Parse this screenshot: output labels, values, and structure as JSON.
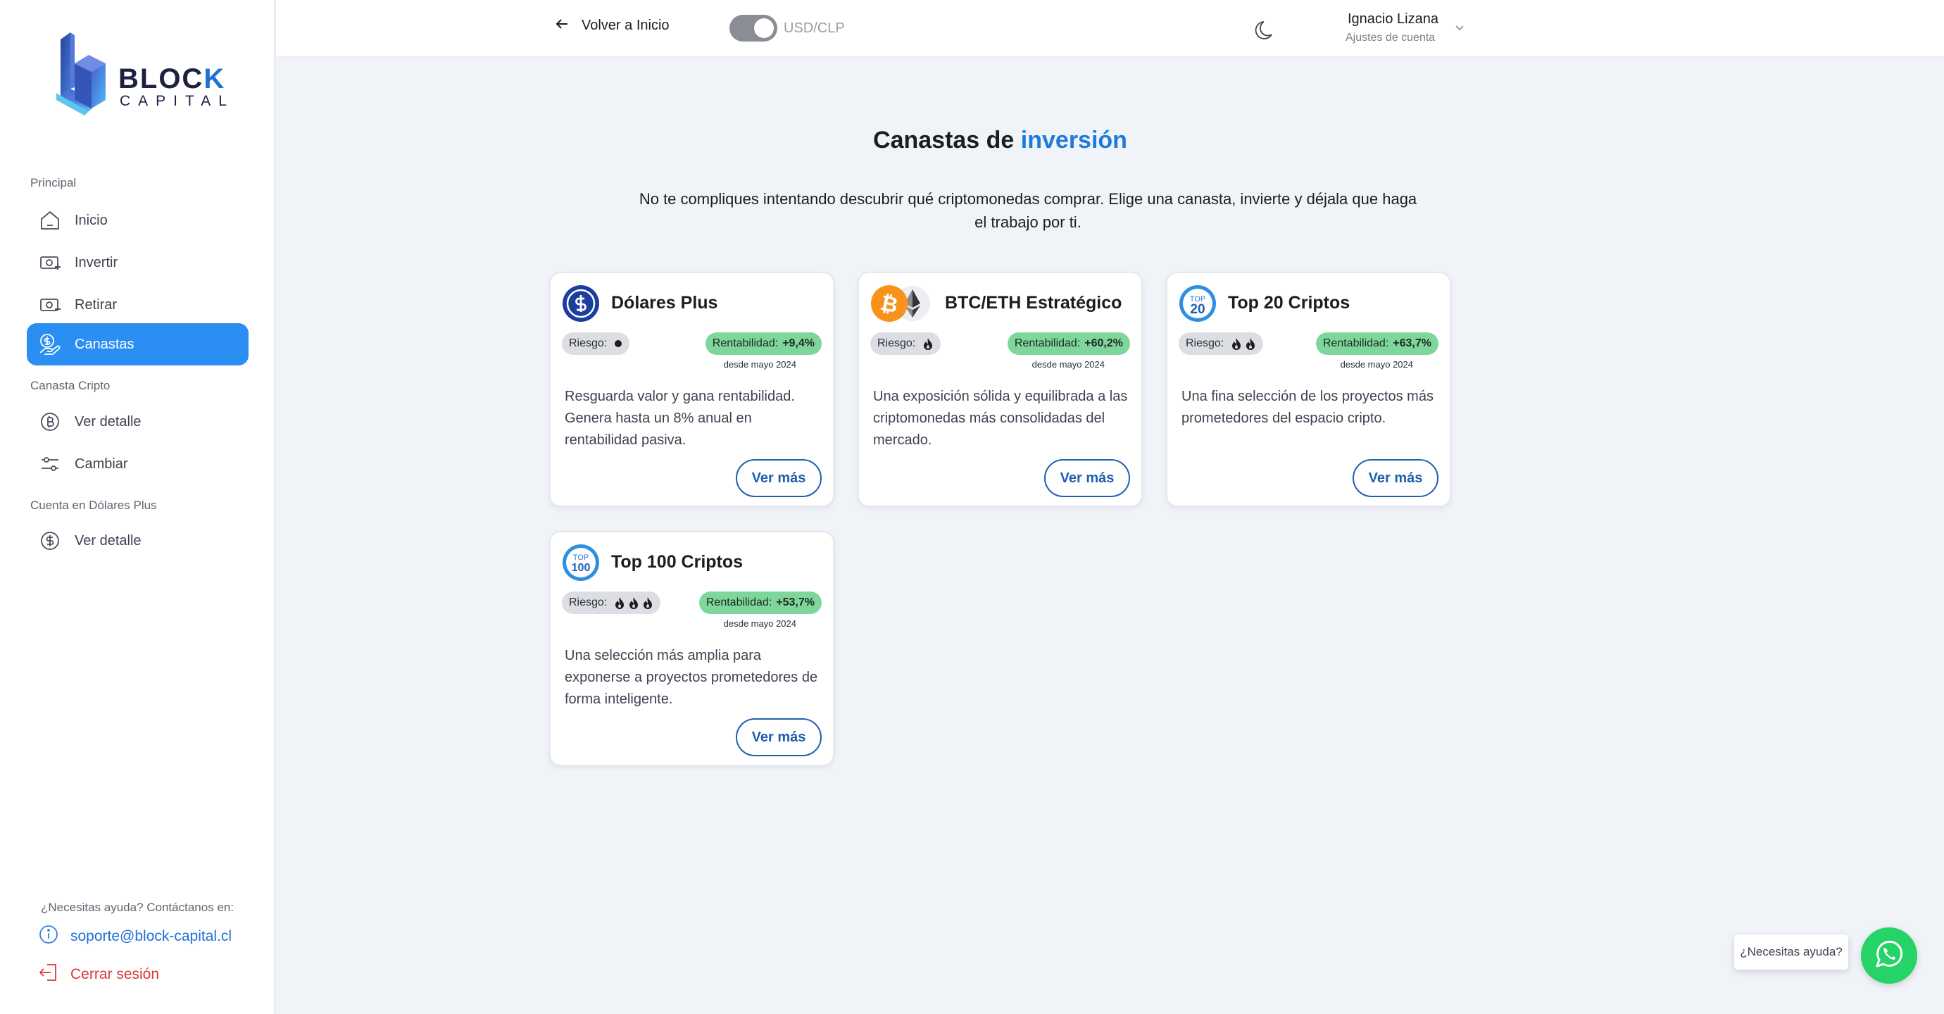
{
  "brand": {
    "name_part1": "BLOC",
    "name_part2": "K",
    "name_sub": "CAPITAL"
  },
  "sidebar": {
    "sections": [
      {
        "label": "Principal"
      },
      {
        "label": "Canasta Cripto"
      },
      {
        "label": "Cuenta en Dólares Plus"
      }
    ],
    "items": [
      {
        "label": "Inicio",
        "icon": "home-icon",
        "active": false
      },
      {
        "label": "Invertir",
        "icon": "cash-plus-icon",
        "active": false
      },
      {
        "label": "Retirar",
        "icon": "cash-minus-icon",
        "active": false
      },
      {
        "label": "Canastas",
        "icon": "coin-hand-icon",
        "active": true
      },
      {
        "label": "Ver detalle",
        "icon": "bitcoin-coin-icon",
        "active": false
      },
      {
        "label": "Cambiar",
        "icon": "sliders-icon",
        "active": false
      },
      {
        "label": "Ver detalle",
        "icon": "dollar-coin-icon",
        "active": false
      }
    ],
    "help_text": "¿Necesitas ayuda? Contáctanos en:",
    "support_email": "soporte@block-capital.cl",
    "logout_label": "Cerrar sesión"
  },
  "topbar": {
    "back_label": "Volver a Inicio",
    "currency_toggle_label": "USD/CLP",
    "user_name": "Ignacio Lizana",
    "user_sub": "Ajustes de cuenta"
  },
  "page": {
    "title_prefix": "Canastas de",
    "title_accent": "inversión",
    "subtitle": "No te compliques intentando descubrir qué criptomonedas comprar. Elige una canasta, invierte y déjala que haga el trabajo por ti."
  },
  "cards": [
    {
      "title": "Dólares Plus",
      "icon": "dollar-coin-icon",
      "risk_label": "Riesgo:",
      "risk_level": 0,
      "rent_label": "Rentabilidad:",
      "rent_value": "+9,4%",
      "since": "desde mayo 2024",
      "description": "Resguarda valor y gana rentabilidad. Genera hasta un 8% anual en rentabilidad pasiva.",
      "button": "Ver más"
    },
    {
      "title": "BTC/ETH Estratégico",
      "icon": "btc-eth-icon",
      "risk_label": "Riesgo:",
      "risk_level": 1,
      "rent_label": "Rentabilidad:",
      "rent_value": "+60,2%",
      "since": "desde mayo 2024",
      "description": "Una exposición sólida y equilibrada a las criptomonedas más consolidadas del mercado.",
      "button": "Ver más"
    },
    {
      "title": "Top 20 Criptos",
      "icon": "top20-icon",
      "icon_text_top": "TOP",
      "icon_text_num": "20",
      "risk_label": "Riesgo:",
      "risk_level": 2,
      "rent_label": "Rentabilidad:",
      "rent_value": "+63,7%",
      "since": "desde mayo 2024",
      "description": "Una fina selección de los proyectos más prometedores del espacio cripto.",
      "button": "Ver más"
    },
    {
      "title": "Top 100 Criptos",
      "icon": "top100-icon",
      "icon_text_top": "TOP",
      "icon_text_num": "100",
      "risk_label": "Riesgo:",
      "risk_level": 3,
      "rent_label": "Rentabilidad:",
      "rent_value": "+53,7%",
      "since": "desde mayo 2024",
      "description": "Una selección más amplia para exponerse a proyectos prometedores de forma inteligente.",
      "button": "Ver más"
    }
  ],
  "help_widget": {
    "label": "¿Necesitas ayuda?",
    "icon": "whatsapp-icon"
  },
  "colors": {
    "accent": "#2a8ef2",
    "title_accent": "#1f7bd9",
    "profit_badge": "#7fd69c",
    "risk_badge": "#dcdee3",
    "logout": "#d9383d",
    "whatsapp": "#25d366"
  }
}
